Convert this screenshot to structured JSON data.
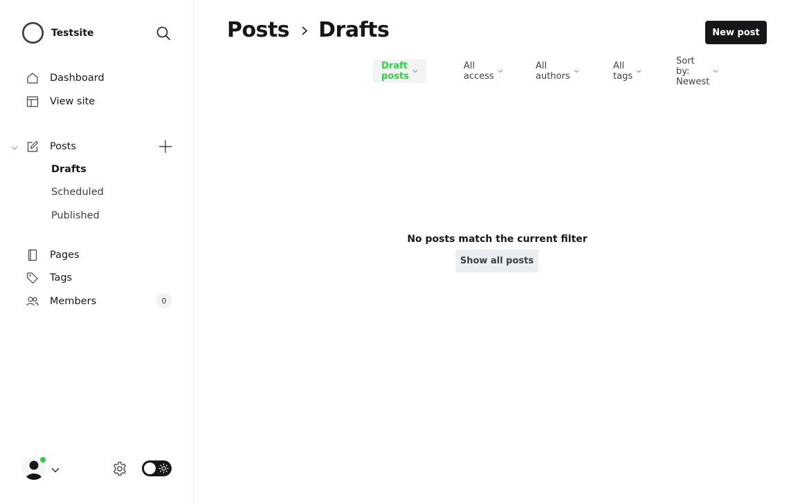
{
  "sidebar": {
    "site_name": "Testsite",
    "nav": {
      "dashboard": "Dashboard",
      "view_site": "View site",
      "posts": "Posts",
      "pages": "Pages",
      "tags": "Tags",
      "members": "Members"
    },
    "posts_sub": {
      "drafts": "Drafts",
      "scheduled": "Scheduled",
      "published": "Published"
    },
    "members_count": "0"
  },
  "header": {
    "breadcrumb_parent": "Posts",
    "breadcrumb_current": "Drafts",
    "new_post_label": "New post"
  },
  "filters": {
    "type": "Draft posts",
    "access": "All access",
    "authors": "All authors",
    "tags": "All tags",
    "sort": "Sort by: Newest"
  },
  "empty_state": {
    "message": "No posts match the current filter",
    "button_label": "Show all posts"
  },
  "colors": {
    "accent_green": "#30cf43",
    "dark": "#15171a"
  },
  "icons": [
    "search-icon",
    "home-icon",
    "layout-icon",
    "edit-icon",
    "plus-icon",
    "page-icon",
    "tag-icon",
    "members-icon",
    "gear-icon",
    "sun-icon",
    "chevron-down-icon",
    "chevron-right-icon"
  ]
}
